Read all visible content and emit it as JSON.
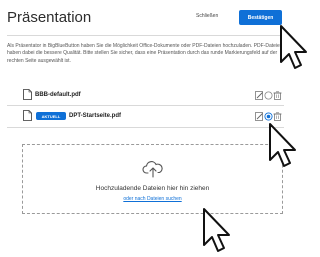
{
  "dialog": {
    "title": "Präsentation",
    "close_label": "Schließen",
    "confirm_label": "Bestätigen",
    "description": "Als Präsentator in BigBlueButton haben Sie die Möglichkeit Office-Dokumente oder PDF-Dateien hochzuladen. PDF-Dateien haben dabei die bessere Qualität. Bitte stellen Sie sicher, dass eine Präsentation durch das runde Markierungsfeld auf der rechten Seite ausgewählt ist."
  },
  "files": [
    {
      "name": "BBB-default.pdf",
      "badge": "",
      "selected": false
    },
    {
      "name": "DPT-Startseite.pdf",
      "badge": "AKTUELL",
      "selected": true
    }
  ],
  "dropzone": {
    "title": "Hochzuladende Dateien hier hin ziehen",
    "link": "oder nach Dateien suchen"
  },
  "colors": {
    "accent": "#0f70d7",
    "text": "#2b2b2b",
    "border": "#9a9a9a"
  },
  "icons": [
    "document-icon",
    "edit-icon",
    "radio-icon",
    "trash-icon",
    "cloud-upload-icon",
    "mouse-cursor-icon"
  ]
}
